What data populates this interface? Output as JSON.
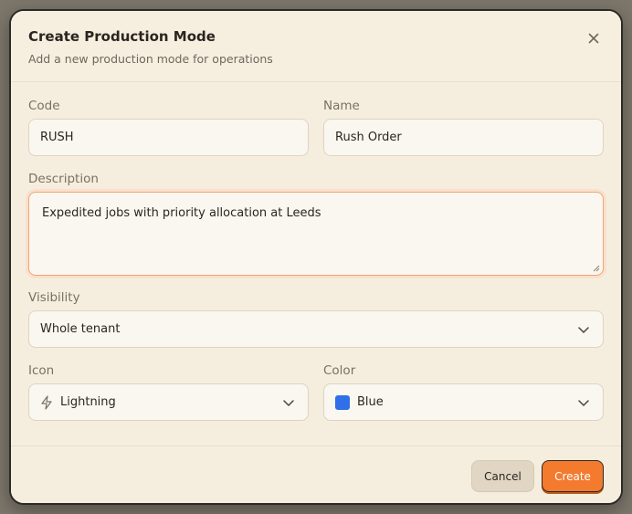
{
  "dialog": {
    "title": "Create Production Mode",
    "subtitle": "Add a new production mode for operations",
    "close_icon": "close-icon"
  },
  "form": {
    "code": {
      "label": "Code",
      "value": "RUSH"
    },
    "name": {
      "label": "Name",
      "value": "Rush Order"
    },
    "description": {
      "label": "Description",
      "value": "Expedited jobs with priority allocation at Leeds"
    },
    "visibility": {
      "label": "Visibility",
      "value": "Whole tenant"
    },
    "icon": {
      "label": "Icon",
      "value": "Lightning",
      "icon_name": "lightning-icon"
    },
    "color": {
      "label": "Color",
      "value": "Blue",
      "swatch": "#2f6fe8"
    }
  },
  "footer": {
    "cancel_label": "Cancel",
    "create_label": "Create"
  },
  "colors": {
    "accent": "#f47a2e",
    "focus_ring": "#eba878",
    "dialog_bg": "#f5eede"
  }
}
